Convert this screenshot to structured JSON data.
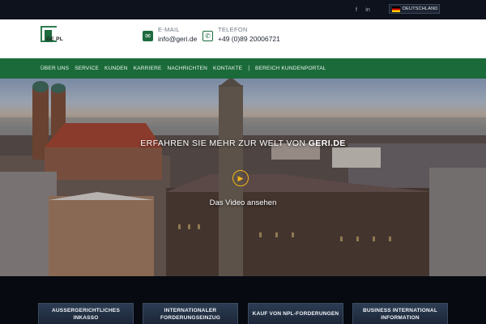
{
  "topbar": {
    "social": [
      {
        "name": "facebook-icon",
        "glyph": "f"
      },
      {
        "name": "linkedin-icon",
        "glyph": "in"
      }
    ],
    "language": "DEUTSCHLAND"
  },
  "header": {
    "logo_text": "GE PL",
    "email_label": "E-MAIL",
    "email_value": "info@geri.de",
    "phone_label": "TELEFON",
    "phone_value": "+49 (0)89 20006721"
  },
  "nav": {
    "items": [
      "ÜBER UNS",
      "SERVICE",
      "KUNDEN",
      "KARRIERE",
      "NACHRICHTEN",
      "KONTAKTE"
    ],
    "separator": "|",
    "portal": "BEREICH KUNDENPORTAL"
  },
  "hero": {
    "title_prefix": "ERFAHREN SIE MEHR ZUR WELT VON ",
    "title_brand": "GERI.DE",
    "video_label": "Das Video ansehen",
    "play_glyph": "▶"
  },
  "services": [
    {
      "label": "AUSSERGERICHTLICHES INKASSO"
    },
    {
      "label": "INTERNATIONALER FORDERUNGSEINZUG"
    },
    {
      "label": "KAUF VON NPL-FORDERUNGEN"
    },
    {
      "label": "BUSINESS INTERNATIONAL INFORMATION"
    }
  ],
  "colors": {
    "brand_green": "#1b6b3a",
    "accent_yellow": "#f2b417",
    "dark": "#0d121c"
  }
}
